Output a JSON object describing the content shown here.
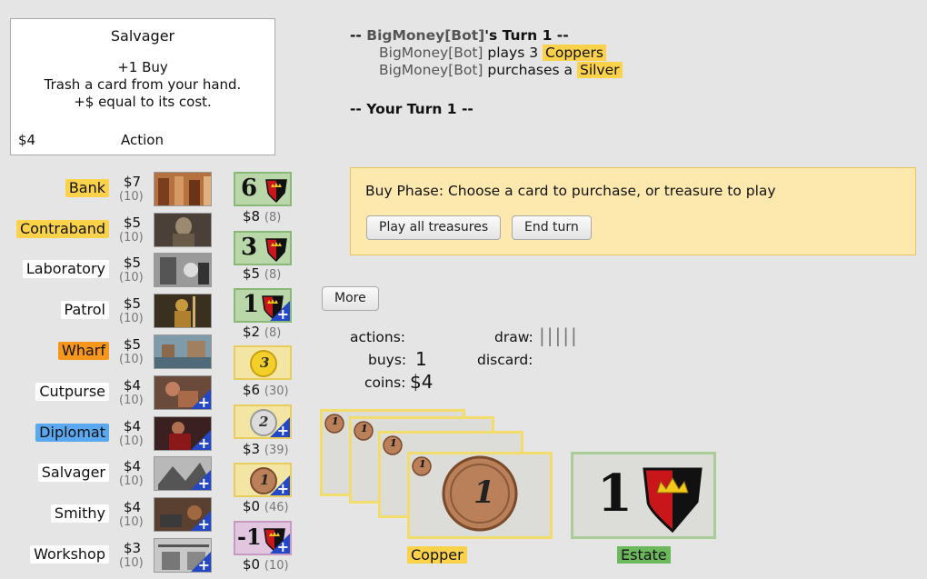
{
  "card_detail": {
    "name": "Salvager",
    "line1": "+1 Buy",
    "line2": "Trash a card from your hand.",
    "line3": "+$ equal to its cost.",
    "cost": "$4",
    "type": "Action"
  },
  "kingdom": [
    {
      "name": "Bank",
      "price": "$7",
      "count": "(10)",
      "color": "#fcd24a"
    },
    {
      "name": "Contraband",
      "price": "$5",
      "count": "(10)",
      "color": "#fcd24a"
    },
    {
      "name": "Laboratory",
      "price": "$5",
      "count": "(10)",
      "color": "#ffffff"
    },
    {
      "name": "Patrol",
      "price": "$5",
      "count": "(10)",
      "color": "#ffffff"
    },
    {
      "name": "Wharf",
      "price": "$5",
      "count": "(10)",
      "color": "#f6961c"
    },
    {
      "name": "Cutpurse",
      "price": "$4",
      "count": "(10)",
      "color": "#ffffff"
    },
    {
      "name": "Diplomat",
      "price": "$4",
      "count": "(10)",
      "color": "#5aa9f0"
    },
    {
      "name": "Salvager",
      "price": "$4",
      "count": "(10)",
      "color": "#ffffff"
    },
    {
      "name": "Smithy",
      "price": "$4",
      "count": "(10)",
      "color": "#ffffff"
    },
    {
      "name": "Workshop",
      "price": "$3",
      "count": "(10)",
      "color": "#ffffff"
    }
  ],
  "base_supply": [
    {
      "card_number": "6",
      "price": "$8",
      "count": "(8)"
    },
    {
      "card_number": "3",
      "price": "$5",
      "count": "(8)"
    },
    {
      "card_number": "1",
      "price": "$2",
      "count": "(8)"
    },
    {
      "card_number": "3",
      "price": "$6",
      "count": "(30)"
    },
    {
      "card_number": "2",
      "price": "$3",
      "count": "(39)"
    },
    {
      "card_number": "1",
      "price": "$0",
      "count": "(46)"
    },
    {
      "card_number": "-1",
      "price": "$0",
      "count": "(10)"
    }
  ],
  "log": {
    "turn_header_prefix": "-- ",
    "bot_name": "BigMoney[Bot]",
    "turn_header_suffix": "'s Turn 1 --",
    "line1_player": "BigMoney[Bot]",
    "line1_action": " plays 3 ",
    "line1_card": "Coppers",
    "line2_player": "BigMoney[Bot]",
    "line2_action": " purchases a ",
    "line2_card": "Silver",
    "your_turn": "-- Your Turn 1 --"
  },
  "prompt": {
    "text": "Buy Phase: Choose a card to purchase, or treasure to play",
    "play_all": "Play all treasures",
    "end_turn": "End turn"
  },
  "more_button": "More",
  "status": {
    "actions_label": "actions:",
    "buys_label": "buys:",
    "buys_value": "1",
    "coins_label": "coins:",
    "coins_value": "$4",
    "draw_label": "draw:",
    "draw_value": "|||||",
    "discard_label": "discard:"
  },
  "hand": {
    "copper_label": "Copper",
    "copper_number": "1",
    "copper_mini": "1",
    "estate_label": "Estate",
    "estate_number": "1"
  },
  "colors": {
    "treasure_highlight": "#fcd24a",
    "victory_highlight": "#6cb85c",
    "attack_blue": "#2447c6",
    "prompt_bg": "#fde9ad"
  }
}
